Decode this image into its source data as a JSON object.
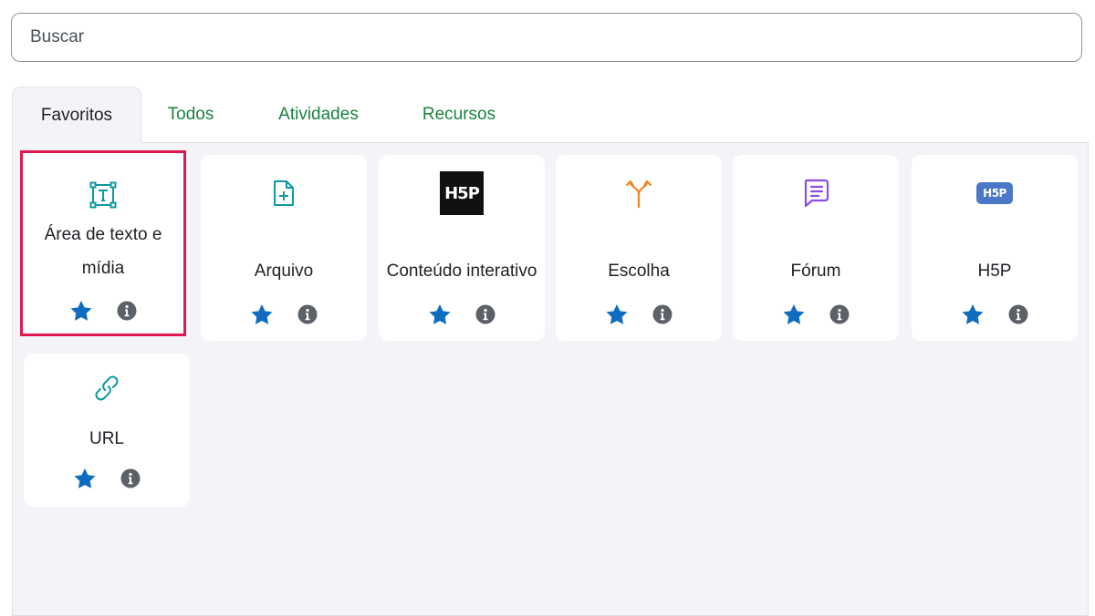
{
  "search": {
    "placeholder": "Buscar",
    "value": ""
  },
  "tabs": [
    {
      "label": "Favoritos",
      "active": true
    },
    {
      "label": "Todos",
      "active": false
    },
    {
      "label": "Atividades",
      "active": false
    },
    {
      "label": "Recursos",
      "active": false
    }
  ],
  "modules": [
    {
      "label": "Área de texto e mídia",
      "icon": "text-area-icon",
      "selected": true,
      "starred": true
    },
    {
      "label": "Arquivo",
      "icon": "file-plus-icon",
      "selected": false,
      "starred": true
    },
    {
      "label": "Conteúdo interativo",
      "icon": "h5p-logo-icon",
      "icon_text": "H5P",
      "selected": false,
      "starred": true
    },
    {
      "label": "Escolha",
      "icon": "choice-arrows-icon",
      "selected": false,
      "starred": true
    },
    {
      "label": "Fórum",
      "icon": "forum-chat-icon",
      "selected": false,
      "starred": true
    },
    {
      "label": "H5P",
      "icon": "h5p-badge-icon",
      "icon_text": "H5P",
      "selected": false,
      "starred": true
    },
    {
      "label": "URL",
      "icon": "link-icon",
      "selected": false,
      "starred": true
    }
  ],
  "colors": {
    "tab_link": "#19843e",
    "star": "#0f6cbf",
    "info": "#5c6168",
    "selection_outline": "#e0174f",
    "text_area_icon": "#0d9aa3",
    "file_icon": "#0d9aa3",
    "choice_icon": "#f28322",
    "forum_icon": "#8f4be6",
    "h5p_badge": "#4a78c6",
    "url_icon": "#0d9aa3"
  }
}
